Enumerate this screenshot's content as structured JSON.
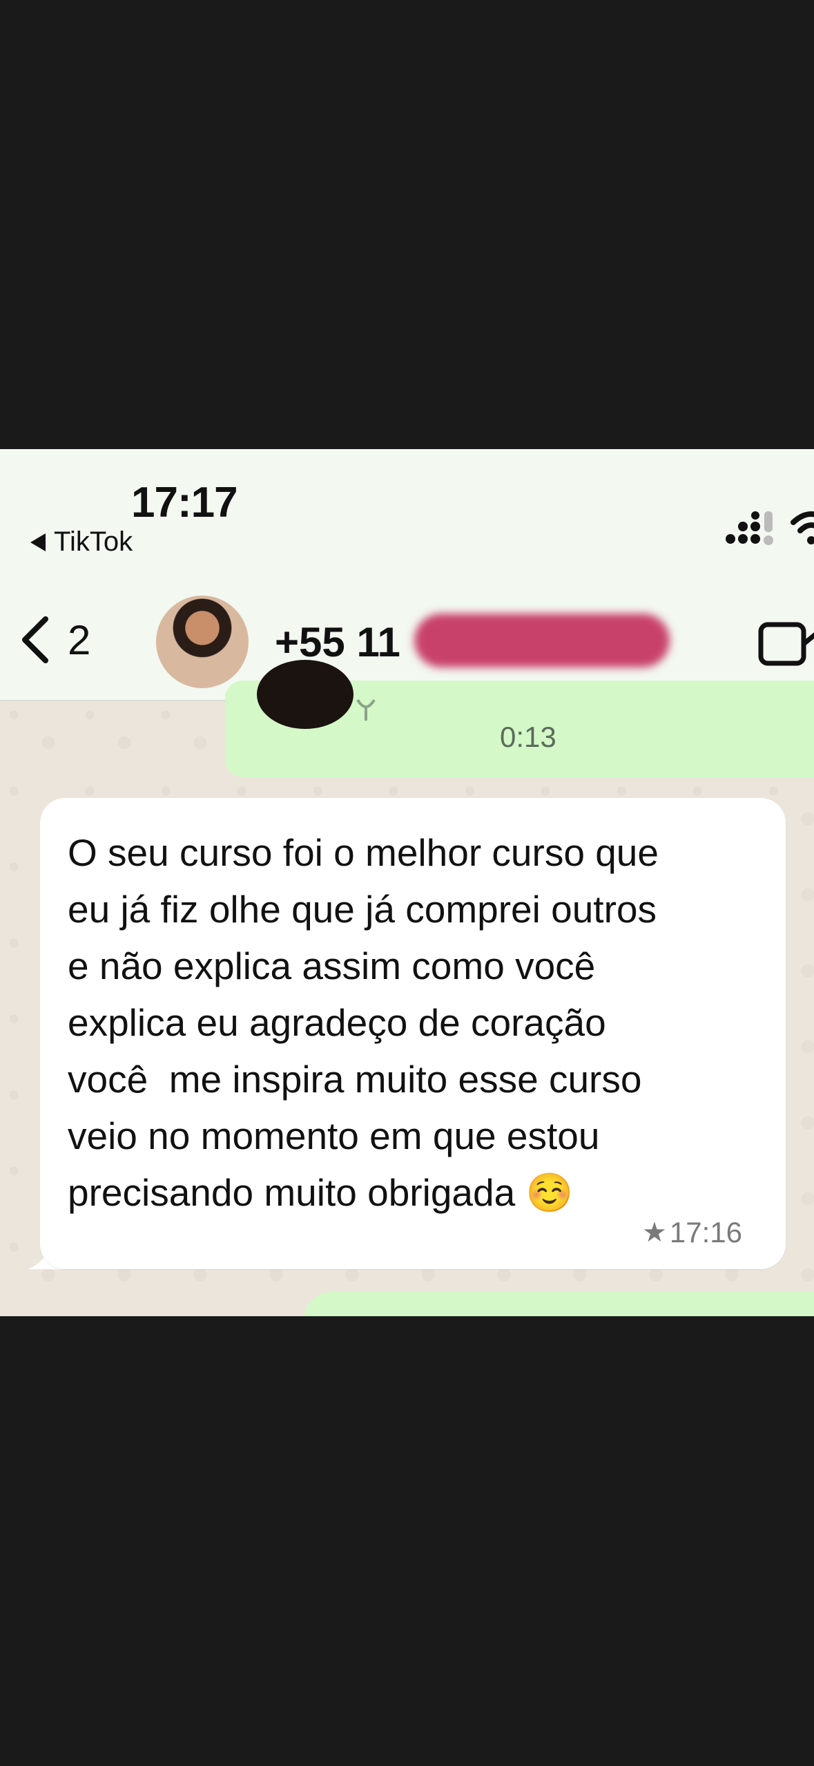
{
  "status_bar": {
    "time": "17:17",
    "back_app_label": "TikTok"
  },
  "chat_header": {
    "unread_count": "2",
    "contact_name": "+55 11"
  },
  "chat": {
    "previous_voice_message": {
      "duration": "0:13"
    },
    "message": {
      "text": "O seu curso foi o melhor curso que\neu já fiz olhe que já comprei outros\ne não explica assim como você\nexplica eu agradeço de coração\nvocê  me inspira muito esse curso\nveio no momento em que estou\nprecisando muito obrigada ☺️",
      "starred": true,
      "time": "17:16"
    }
  },
  "colors": {
    "background": "#1a1a1b",
    "header_background": "#f3f8f1",
    "outgoing_bubble": "#d4f8c7",
    "incoming_bubble": "#ffffff",
    "redaction": "#c8416b"
  },
  "icons": {
    "back": "chevron-left-icon",
    "video_call": "video-camera-icon",
    "signal": "cellular-signal-icon",
    "wifi": "wifi-icon",
    "star": "star-icon",
    "mic": "microphone-icon"
  }
}
